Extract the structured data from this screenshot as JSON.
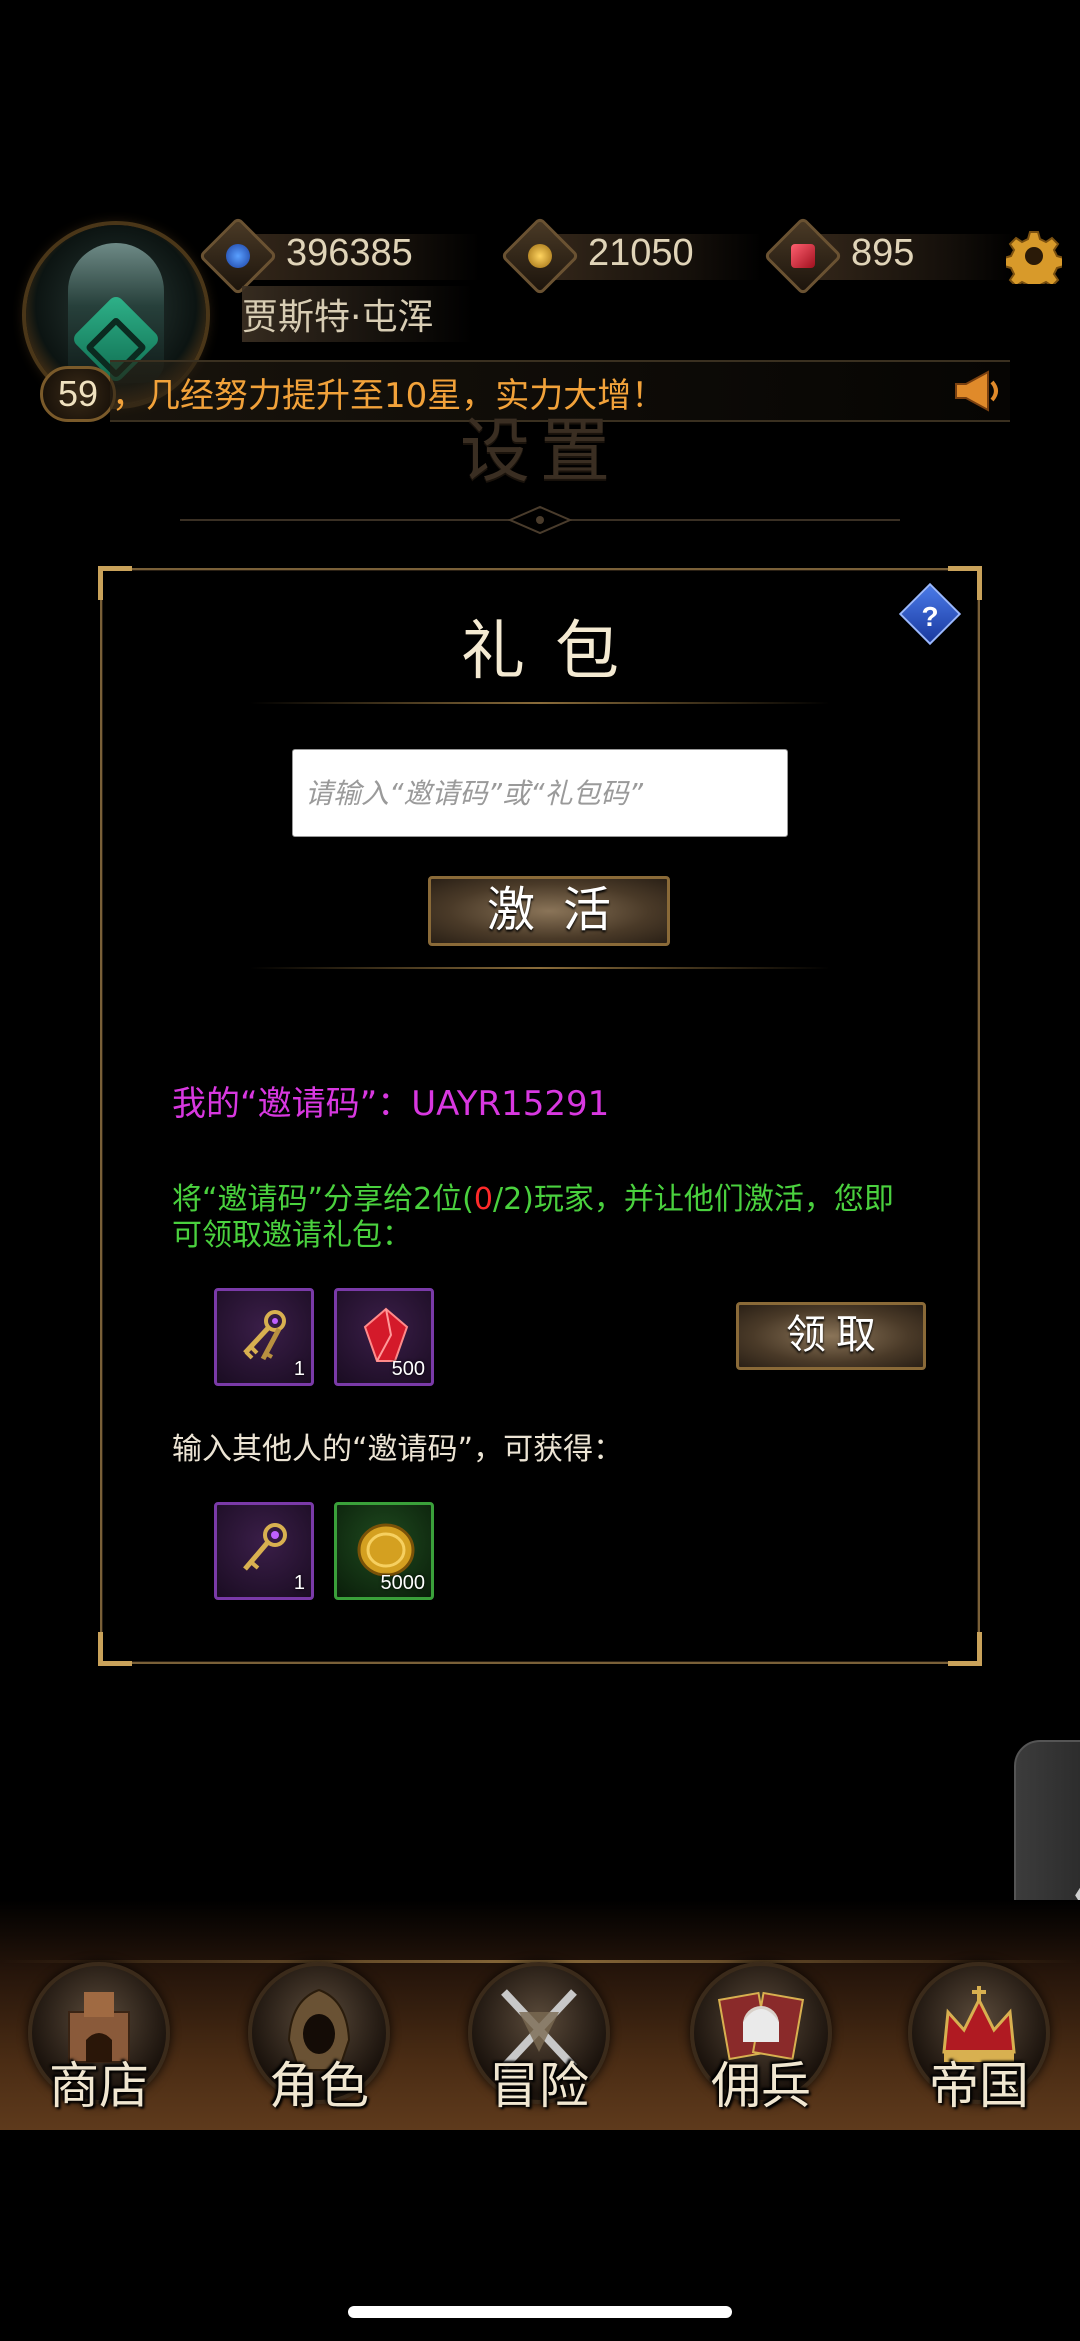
{
  "hud": {
    "level": "59",
    "player_name": "贾斯特·屯浑",
    "resources": [
      {
        "icon": "blue-crystal-icon",
        "value": "396385"
      },
      {
        "icon": "gold-coin-icon",
        "value": "21050"
      },
      {
        "icon": "red-gem-icon",
        "value": "895"
      }
    ],
    "ticker": "，几经努力提升至10星，实力大增！"
  },
  "page": {
    "title": "设置"
  },
  "gift_panel": {
    "title": "礼包",
    "help_label": "?",
    "input_placeholder": "请输入“邀请码”或“礼包码”",
    "activate_label": "激活",
    "my_code_text": "我的“邀请码”：UAYR15291",
    "share_text_before": "将“邀请码”分享给2位(",
    "share_count": "0",
    "share_text_after": "/2)玩家，并让他们激活，您即可领取邀请礼包：",
    "invite_rewards": [
      {
        "icon": "keys-icon",
        "qty": "1",
        "rarity": "purple"
      },
      {
        "icon": "red-gem-icon",
        "qty": "500",
        "rarity": "purple"
      }
    ],
    "claim_label": "领取",
    "others_text": "输入其他人的“邀请码”，可获得：",
    "redeem_rewards": [
      {
        "icon": "key-icon",
        "qty": "1",
        "rarity": "purple"
      },
      {
        "icon": "gold-coin-icon",
        "qty": "5000",
        "rarity": "green"
      }
    ]
  },
  "side_handle_glyph": "〈",
  "nav": [
    {
      "label": "商店",
      "icon": "shop-castle-icon"
    },
    {
      "label": "角色",
      "icon": "hooded-character-icon"
    },
    {
      "label": "冒险",
      "icon": "crossed-swords-icon"
    },
    {
      "label": "佣兵",
      "icon": "mercenary-cards-icon"
    },
    {
      "label": "帝国",
      "icon": "crown-icon"
    }
  ],
  "colors": {
    "invite_code": "#d838e0",
    "share_text": "#4ad13e",
    "share_count": "#ff2a2a",
    "ticker": "#f2a23a"
  }
}
